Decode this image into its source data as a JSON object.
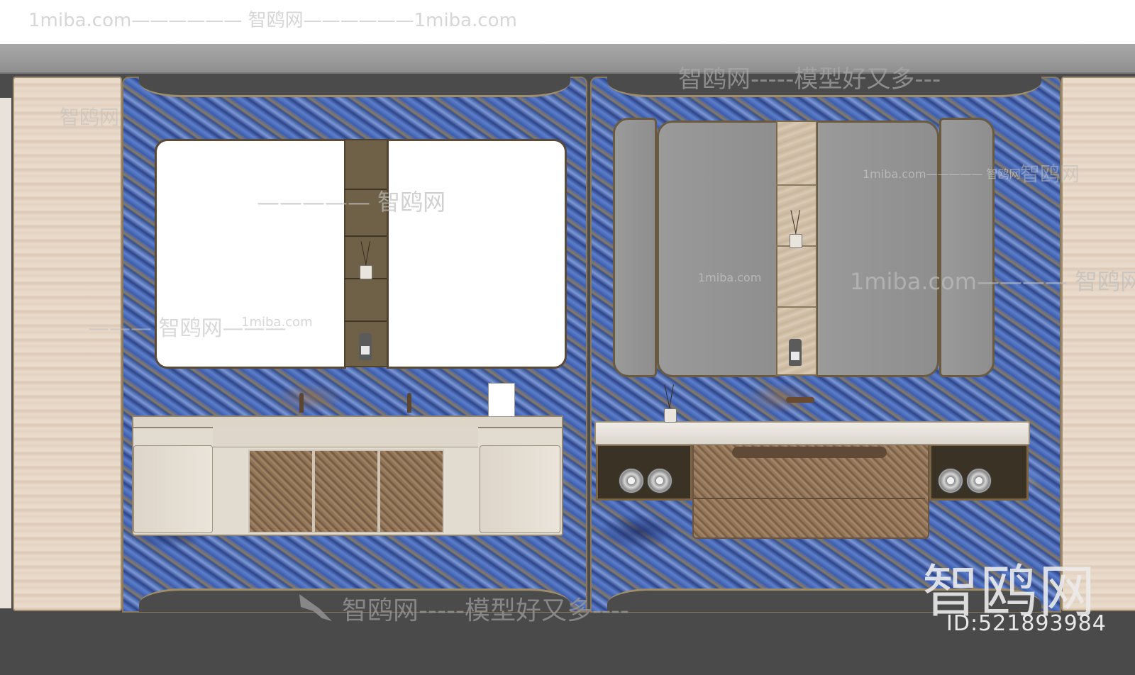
{
  "watermarks": {
    "top_left": "1miba.com——————  智鸥网——————1miba.com",
    "top_right": "智鸥网-----模型好又多---",
    "mirror_left": "————— 智鸥网",
    "mirror_right": "1miba.com———— 智鸥网—————",
    "mirror_right_small": "1miba.com",
    "mirror_right_small_2": "1miba.com————— 智鸥网",
    "mirror_left_small": "1miba.com",
    "left_panel": "——— 智鸥网———",
    "left_column": "智鸥网",
    "right_column": "智鸥网",
    "bottom": "智鸥网-----模型好又多----",
    "logo_big": "智鸥网",
    "id_label": "ID:521893984"
  },
  "icons": {
    "bird": "bird-logo-icon"
  },
  "colors": {
    "marble_blue": "#3b5aa8",
    "travertine": "#e7d6c6",
    "bronze_trim": "#a08d6a"
  }
}
